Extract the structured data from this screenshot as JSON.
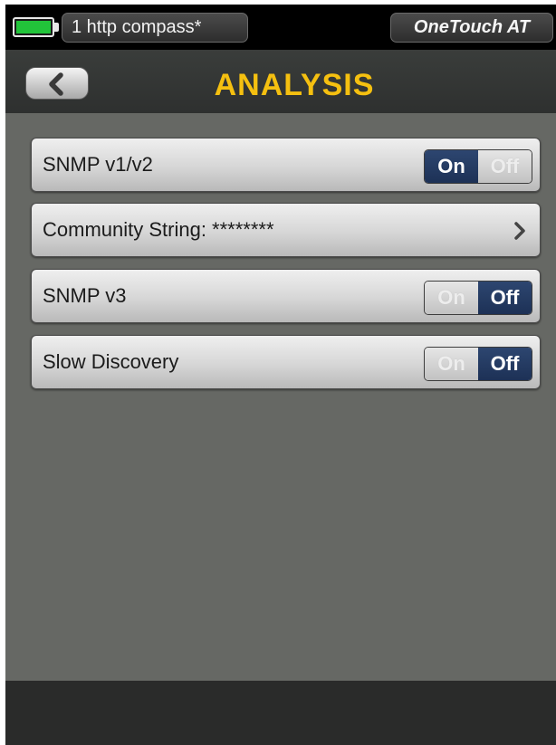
{
  "status_bar": {
    "battery_icon": "battery-full-icon",
    "battery_color": "#22c43a",
    "profile_label": "1 http compass*",
    "model_label": "OneTouch AT"
  },
  "header": {
    "back_icon": "chevron-left-icon",
    "title": "ANALYSIS",
    "title_color": "#f5c010"
  },
  "settings": {
    "snmp_v1v2": {
      "label": "SNMP v1/v2",
      "on_label": "On",
      "off_label": "Off",
      "state": "On"
    },
    "community_string": {
      "label": "Community String: ********",
      "icon": "chevron-right-icon"
    },
    "snmp_v3": {
      "label": "SNMP v3",
      "on_label": "On",
      "off_label": "Off",
      "state": "Off"
    },
    "slow_discovery": {
      "label": "Slow Discovery",
      "on_label": "On",
      "off_label": "Off",
      "state": "Off"
    }
  },
  "colors": {
    "toggle_active": "#1d3156",
    "content_background": "#666864"
  }
}
